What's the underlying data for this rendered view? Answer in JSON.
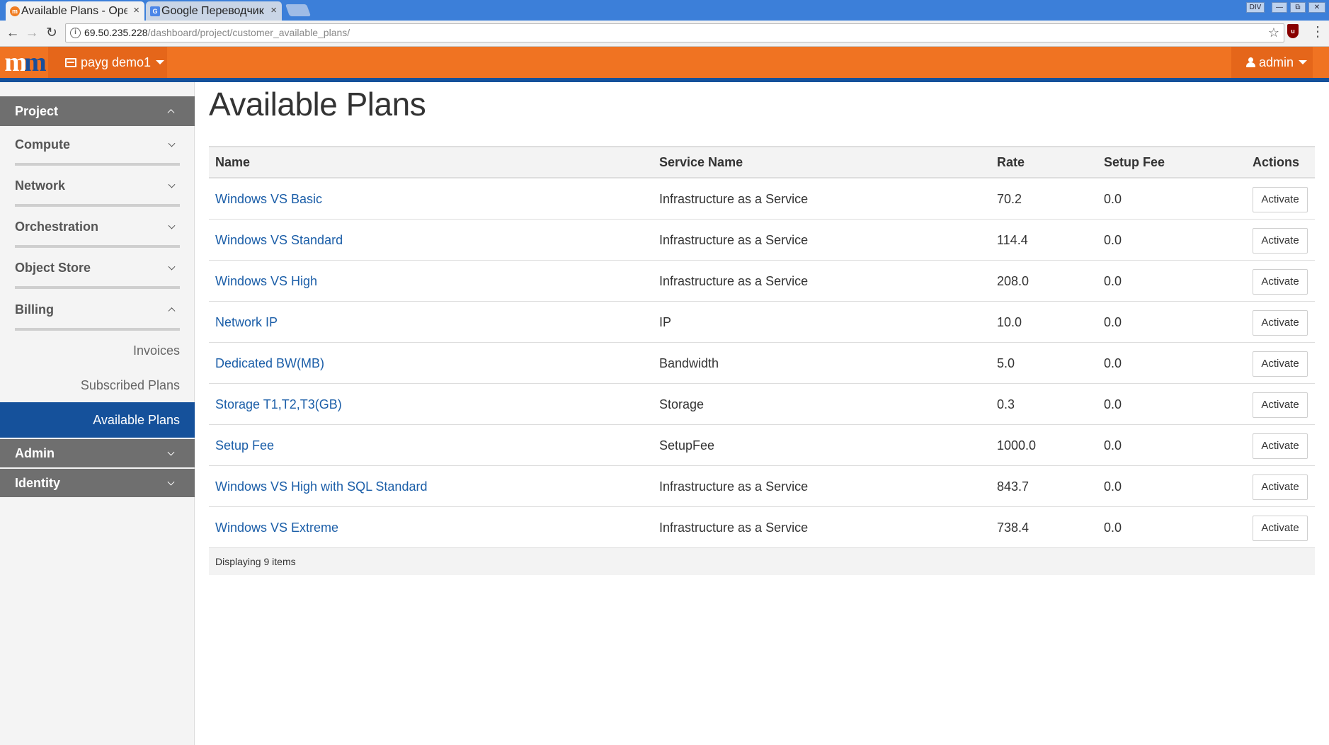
{
  "browser": {
    "tabs": [
      {
        "title": "Available Plans - Ope",
        "close": "×",
        "active": true
      },
      {
        "title": "Google Переводчик",
        "close": "×",
        "active": false
      }
    ],
    "window_controls": {
      "extra": "DIV",
      "minimize": "—",
      "restore": "⧉",
      "close": "✕"
    },
    "url_host": "69.50.235.228",
    "url_path": "/dashboard/project/customer_available_plans/"
  },
  "header": {
    "logo_text": "m",
    "project_selector": "payg demo1",
    "user_menu": "admin",
    "colors": {
      "bar": "#f07322",
      "accent_line": "#15519b"
    }
  },
  "sidebar": {
    "project": "Project",
    "groups": [
      {
        "label": "Compute"
      },
      {
        "label": "Network"
      },
      {
        "label": "Orchestration"
      },
      {
        "label": "Object Store"
      },
      {
        "label": "Billing"
      }
    ],
    "billing_links": [
      {
        "label": "Invoices",
        "active": false
      },
      {
        "label": "Subscribed Plans",
        "active": false
      },
      {
        "label": "Available Plans",
        "active": true
      }
    ],
    "admin": "Admin",
    "identity": "Identity"
  },
  "main": {
    "title": "Available Plans",
    "columns": [
      "Name",
      "Service Name",
      "Rate",
      "Setup Fee",
      "Actions"
    ],
    "rows": [
      {
        "name": "Windows VS Basic",
        "service": "Infrastructure as a Service",
        "rate": "70.2",
        "setup_fee": "0.0",
        "action": "Activate"
      },
      {
        "name": "Windows VS Standard",
        "service": "Infrastructure as a Service",
        "rate": "114.4",
        "setup_fee": "0.0",
        "action": "Activate"
      },
      {
        "name": "Windows VS High",
        "service": "Infrastructure as a Service",
        "rate": "208.0",
        "setup_fee": "0.0",
        "action": "Activate"
      },
      {
        "name": "Network IP",
        "service": "IP",
        "rate": "10.0",
        "setup_fee": "0.0",
        "action": "Activate"
      },
      {
        "name": "Dedicated BW(MB)",
        "service": "Bandwidth",
        "rate": "5.0",
        "setup_fee": "0.0",
        "action": "Activate"
      },
      {
        "name": "Storage T1,T2,T3(GB)",
        "service": "Storage",
        "rate": "0.3",
        "setup_fee": "0.0",
        "action": "Activate"
      },
      {
        "name": "Setup Fee",
        "service": "SetupFee",
        "rate": "1000.0",
        "setup_fee": "0.0",
        "action": "Activate"
      },
      {
        "name": "Windows VS High with SQL Standard",
        "service": "Infrastructure as a Service",
        "rate": "843.7",
        "setup_fee": "0.0",
        "action": "Activate"
      },
      {
        "name": "Windows VS Extreme",
        "service": "Infrastructure as a Service",
        "rate": "738.4",
        "setup_fee": "0.0",
        "action": "Activate"
      }
    ],
    "footer": "Displaying 9 items"
  }
}
